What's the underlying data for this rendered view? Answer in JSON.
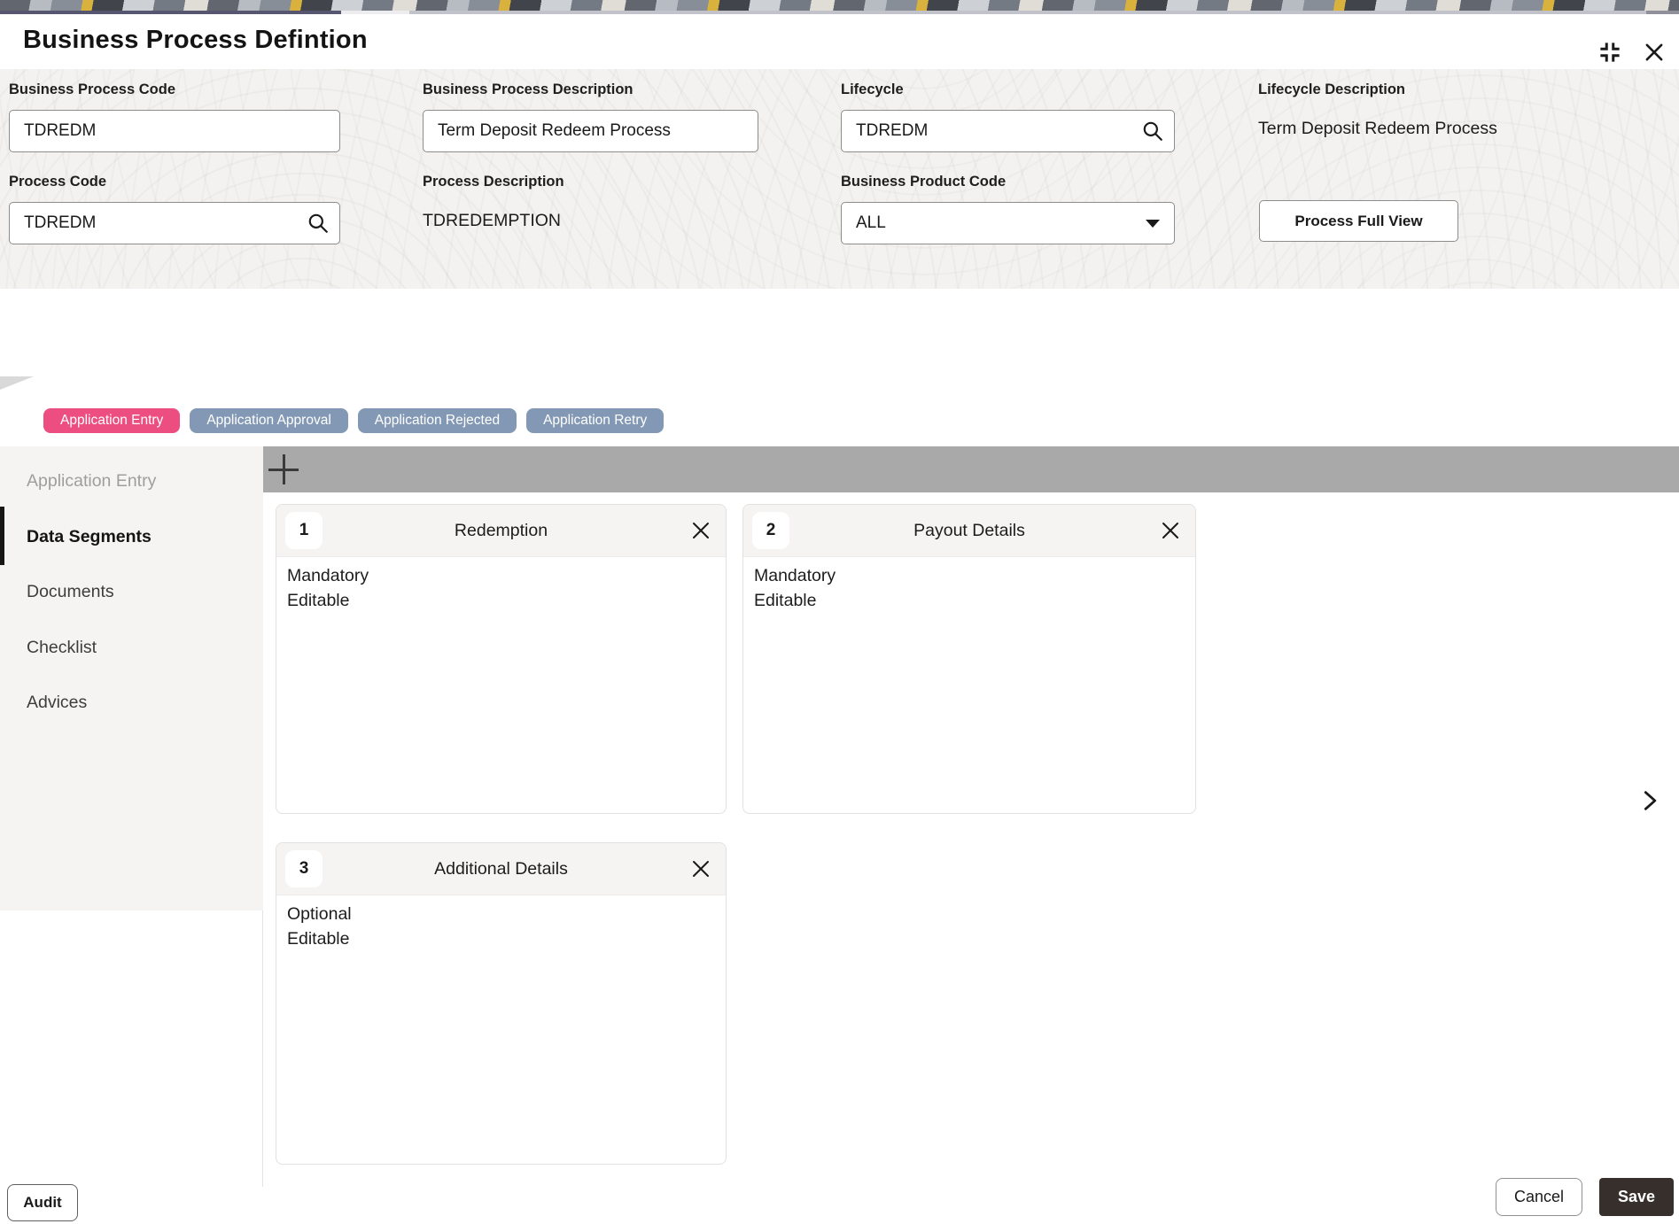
{
  "header": {
    "title": "Business Process Defintion"
  },
  "form": {
    "business_process_code": {
      "label": "Business Process Code",
      "value": "TDREDM"
    },
    "business_process_description": {
      "label": "Business Process Description",
      "value": "Term Deposit Redeem Process"
    },
    "lifecycle": {
      "label": "Lifecycle",
      "value": "TDREDM"
    },
    "lifecycle_description": {
      "label": "Lifecycle Description",
      "value": "Term Deposit Redeem Process"
    },
    "process_code": {
      "label": "Process Code",
      "value": "TDREDM"
    },
    "process_description": {
      "label": "Process Description",
      "value": "TDREDEMPTION"
    },
    "business_product_code": {
      "label": "Business Product Code",
      "value": "ALL"
    },
    "process_full_view_label": "Process Full View"
  },
  "stage_tabs": [
    {
      "label": "Application Entry",
      "active": true
    },
    {
      "label": "Application Approval",
      "active": false
    },
    {
      "label": "Application Rejected",
      "active": false
    },
    {
      "label": "Application Retry",
      "active": false
    }
  ],
  "sidebar": {
    "items": [
      {
        "label": "Application Entry",
        "state": "disabled"
      },
      {
        "label": "Data Segments",
        "state": "active"
      },
      {
        "label": "Documents",
        "state": "normal"
      },
      {
        "label": "Checklist",
        "state": "normal"
      },
      {
        "label": "Advices",
        "state": "normal"
      }
    ]
  },
  "segments": {
    "cards": [
      {
        "number": "1",
        "title": "Redemption",
        "attributes": [
          "Mandatory",
          "Editable"
        ]
      },
      {
        "number": "2",
        "title": "Payout Details",
        "attributes": [
          "Mandatory",
          "Editable"
        ]
      },
      {
        "number": "3",
        "title": "Additional Details",
        "attributes": [
          "Optional",
          "Editable"
        ]
      }
    ]
  },
  "footer": {
    "audit_label": "Audit",
    "cancel_label": "Cancel",
    "save_label": "Save"
  },
  "colors": {
    "active_stage_tab": "#ed4e82",
    "inactive_stage_tab": "#8398b4",
    "save_button_bg": "#362f2b",
    "add_bar_bg": "#a9a9a9",
    "sidebar_bg": "#f5f4f3",
    "card_header_bg": "#f6f4f2"
  }
}
